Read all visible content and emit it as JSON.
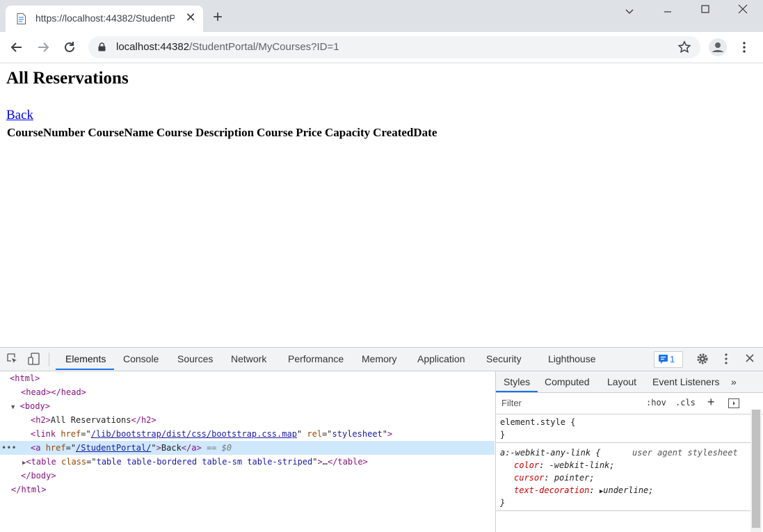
{
  "browser": {
    "tab_title": "https://localhost:44382/StudentP",
    "url_host": "localhost:44382",
    "url_path": "/StudentPortal/MyCourses?ID=1"
  },
  "page": {
    "heading": "All Reservations",
    "back_link": "Back",
    "table_headers": [
      "CourseNumber",
      "CourseName",
      "Course Description",
      "Course Price",
      "Capacity",
      "CreatedDate"
    ]
  },
  "devtools": {
    "tabs": [
      "Elements",
      "Console",
      "Sources",
      "Network",
      "Performance",
      "Memory",
      "Application",
      "Security",
      "Lighthouse"
    ],
    "issues_count": "1",
    "dom_lines": {
      "html_open": "<html>",
      "head": "<head></head>",
      "body_open": "<body>",
      "h2_text": "All Reservations",
      "link_href": "/lib/bootstrap/dist/css/bootstrap.css.map",
      "link_rel": "stylesheet",
      "a_href": "/StudentPortal/",
      "a_text": "Back",
      "dollar0": "== $0",
      "table_class": "table table-bordered table-sm table-striped",
      "body_close": "</body>",
      "html_close": "</html>"
    },
    "styles": {
      "tabs": [
        "Styles",
        "Computed",
        "Layout",
        "Event Listeners"
      ],
      "filter_placeholder": "Filter",
      "hov": ":hov",
      "cls": ".cls",
      "element_style": "element.style {",
      "close_brace": "}",
      "rule_selector": "a:-webkit-any-link {",
      "rule_origin": "user agent stylesheet",
      "props": [
        {
          "name": "color",
          "value": "-webkit-link;"
        },
        {
          "name": "cursor",
          "value": "pointer;"
        },
        {
          "name": "text-decoration",
          "value": "underline;"
        }
      ]
    }
  }
}
